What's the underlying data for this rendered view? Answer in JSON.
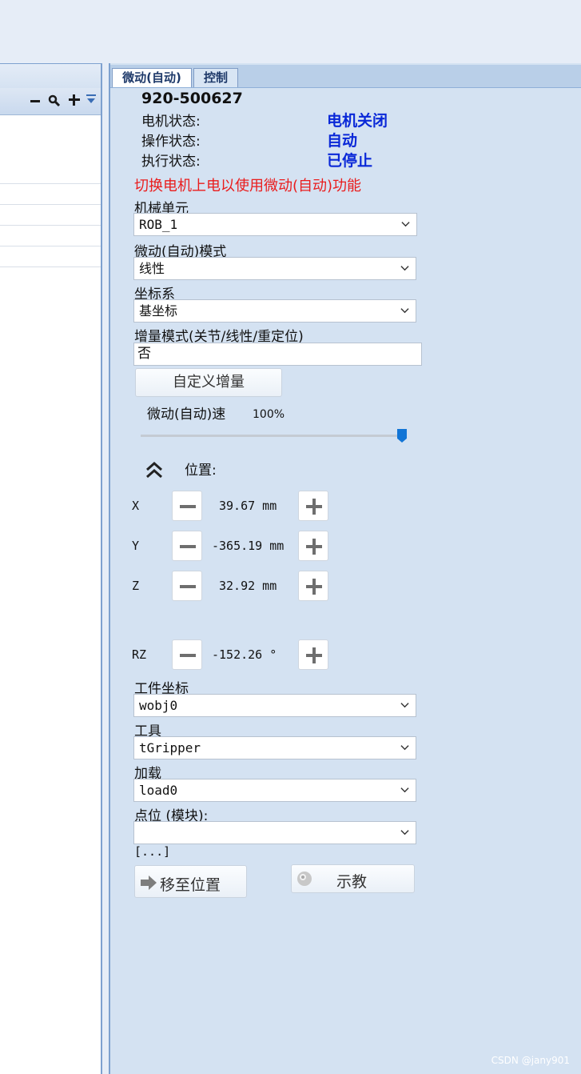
{
  "left_panel": {
    "toolbar_icons": [
      "minus-icon",
      "search-icon",
      "plus-icon",
      "dropdown-icon"
    ]
  },
  "tabs": [
    {
      "label": "微动(自动)",
      "active": true
    },
    {
      "label": "控制",
      "active": false
    }
  ],
  "device": {
    "id": "920-500627"
  },
  "status": [
    {
      "label": "电机状态:",
      "value": "电机关闭"
    },
    {
      "label": "操作状态:",
      "value": "自动"
    },
    {
      "label": "执行状态:",
      "value": "已停止"
    }
  ],
  "warning": "切换电机上电以使用微动(自动)功能",
  "fields": {
    "mech_unit": {
      "label": "机械单元",
      "value": "ROB_1"
    },
    "jog_mode": {
      "label": "微动(自动)模式",
      "value": "线性"
    },
    "coord_sys": {
      "label": "坐标系",
      "value": "基坐标"
    },
    "incr_mode": {
      "label": "增量模式(关节/线性/重定位)",
      "value": "否"
    }
  },
  "custom_increment_button": "自定义增量",
  "speed": {
    "label": "微动(自动)速",
    "value_text": "100%",
    "value_fraction": 1.0
  },
  "position": {
    "label": "位置:",
    "axes": [
      {
        "name": "X",
        "value": "39.67 mm"
      },
      {
        "name": "Y",
        "value": "-365.19 mm"
      },
      {
        "name": "Z",
        "value": "32.92 mm"
      },
      {
        "name": "RZ",
        "value": "-152.26 °"
      }
    ]
  },
  "lower_fields": {
    "workobj": {
      "label": "工件坐标",
      "value": "wobj0"
    },
    "tool": {
      "label": "工具",
      "value": "tGripper"
    },
    "load": {
      "label": "加载",
      "value": "load0"
    },
    "point": {
      "label": "点位 (模块):",
      "value": ""
    }
  },
  "ellipsis": "[...]",
  "move_to_button": "移至位置",
  "teach_button": "示教",
  "watermark": "CSDN @jany901",
  "colors": {
    "status_value": "#0a28d8",
    "warning": "#ea1c1c",
    "slider": "#1275d6",
    "panel_bg": "#d4e2f2"
  }
}
